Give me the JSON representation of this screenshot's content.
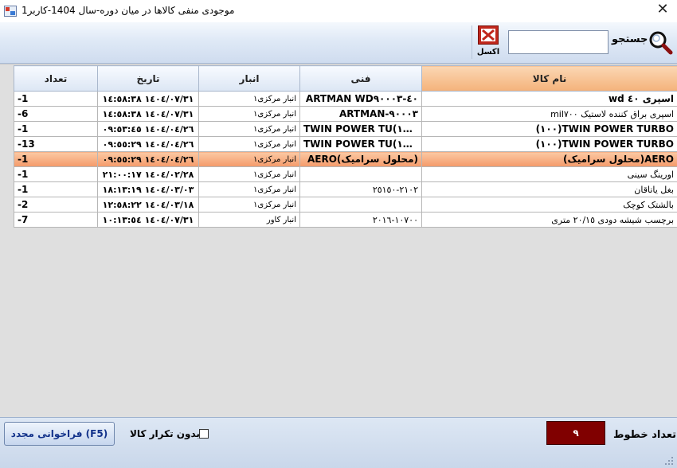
{
  "window": {
    "title": "موجودی منفی کالاها در میان دوره-سال 1404-کاربر1",
    "close_symbol": "✕"
  },
  "toolbar": {
    "search_label": "جستجو",
    "search_value": "",
    "excel_label": "اکسل"
  },
  "grid": {
    "columns": {
      "name": "نام کالا",
      "tech": "فنی",
      "store": "انبار",
      "date": "تاریخ",
      "count": "تعداد"
    },
    "rows": [
      {
        "name": "اسپری ٤٠ wd",
        "tech": "ARTMAN   WD٤٠-٩٠٠٠٣",
        "store": "انبار مرکزی١",
        "date": "١٤٠٤/٠٧/٣١ ١٤:٥٨:٣٨",
        "count": "-1"
      },
      {
        "name": "اسپری براق کننده لاستیک mil٧٠٠",
        "tech": "ARTMAN-٩٠٠٠٣",
        "store": "انبار مرکزی١",
        "date": "١٤٠٤/٠٧/٣١ ١٤:٥٨:٣٨",
        "count": "-6"
      },
      {
        "name": "TWIN POWER TURBO(١٠٠)",
        "tech": "TWIN POWER TU(١٠٠)...",
        "store": "انبار مرکزی١",
        "date": "١٤٠٤/٠٤/٢٦ ٠٩:٥٣:٤٥",
        "count": "-1"
      },
      {
        "name": "TWIN POWER TURBO(١٠٠)",
        "tech": "TWIN POWER TU(١٠٠)...",
        "store": "انبار مرکزی١",
        "date": "١٤٠٤/٠٤/٢٦ ٠٩:٥٥:٢٩",
        "count": "-13"
      },
      {
        "name": "AERO(محلول سرامیک)",
        "tech": "AERO(محلول سرامیک)",
        "store": "انبار مرکزی١",
        "date": "١٤٠٤/٠٤/٢٦ ٠٩:٥٥:٢٩",
        "count": "-1"
      },
      {
        "name": "اورینگ سینی",
        "tech": "",
        "store": "انبار مرکزی١",
        "date": "١٤٠٤/٠٢/٢٨ ٢١:٠٠:١٧",
        "count": "-1"
      },
      {
        "name": "بغل یاتاقان",
        "tech": "٢١٠٢-٢٥١٥٠",
        "store": "انبار مرکزی١",
        "date": "١٤٠٤/٠٣/٠٣ ١٨:١٣:١٩",
        "count": "-1"
      },
      {
        "name": "بالشتک کوچک",
        "tech": "",
        "store": "انبار مرکزی١",
        "date": "١٤٠٤/٠٣/١٨ ١٢:٥٨:٢٢",
        "count": "-2"
      },
      {
        "name": "برچسب شیشه دودی ٢٠/١٥ متری",
        "tech": "١٠٧٠٠-٢٠١٦",
        "store": "انبار کاور",
        "date": "١٤٠٤/٠٧/٣١ ١٠:١٣:٥٤",
        "count": "-7"
      }
    ]
  },
  "footer": {
    "row_count_label": "تعداد خطوط",
    "row_count_value": "٩",
    "no_duplicate_label": "بدون تکرار کالا",
    "no_duplicate_checked": false,
    "reload_label": "فراخوانی مجدد (F5)"
  },
  "colors": {
    "selected_row": "#f49a6a",
    "sorted_header": "#f4b27a",
    "count_box": "#800000",
    "excel_red": "#c0271c"
  }
}
